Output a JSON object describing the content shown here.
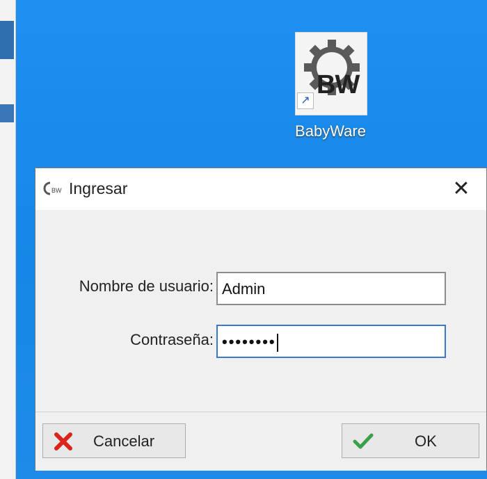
{
  "desktop": {
    "shortcut": {
      "label": "BabyWare",
      "logo_text": "BW",
      "icon": "babyware-gear-icon"
    }
  },
  "dialog": {
    "title": "Ingresar",
    "title_icon": "babyware-app-icon",
    "close_icon": "close-icon",
    "close_glyph": "✕",
    "fields": {
      "username": {
        "label": "Nombre de usuario:",
        "value": "Admin"
      },
      "password": {
        "label": "Contraseña:",
        "masked_value": "••••••••"
      }
    },
    "buttons": {
      "cancel": {
        "label": "Cancelar",
        "icon": "red-x-icon"
      },
      "ok": {
        "label": "OK",
        "icon": "green-check-icon"
      }
    }
  },
  "colors": {
    "desktop_blue": "#1d8ae6",
    "cancel_icon": "#d9261c",
    "ok_icon": "#3aa04a",
    "focus_border": "#3a78c9"
  }
}
